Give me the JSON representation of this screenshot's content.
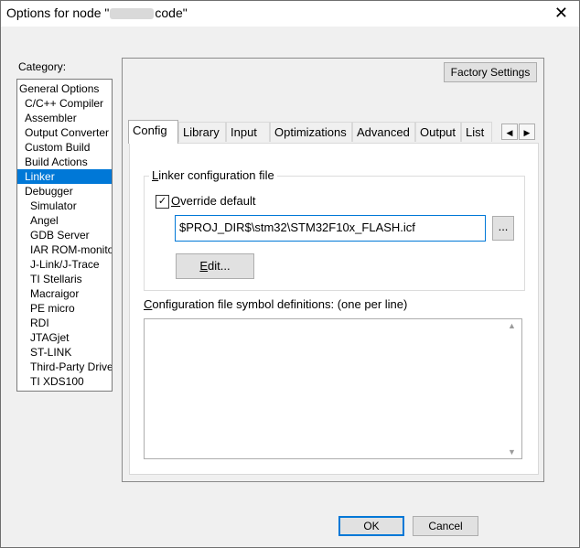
{
  "window": {
    "title_prefix": "Options for node \"",
    "title_suffix": "code\"",
    "close_glyph": "✕"
  },
  "category": {
    "label": "Category:",
    "items": [
      "General Options",
      "C/C++ Compiler",
      "Assembler",
      "Output Converter",
      "Custom Build",
      "Build Actions",
      "Linker",
      "Debugger",
      "Simulator",
      "Angel",
      "GDB Server",
      "IAR ROM-monitor",
      "J-Link/J-Trace",
      "TI Stellaris",
      "Macraigor",
      "PE micro",
      "RDI",
      "JTAGjet",
      "ST-LINK",
      "Third-Party Driver",
      "TI XDS100"
    ],
    "selected": "Linker"
  },
  "buttons": {
    "factory": "Factory Settings",
    "ok": "OK",
    "cancel": "Cancel",
    "browse": "...",
    "edit": "Edit..."
  },
  "tabs": [
    "Config",
    "Library",
    "Input",
    "Optimizations",
    "Advanced",
    "Output",
    "List"
  ],
  "active_tab": "Config",
  "tab_scroll": {
    "left": "◀",
    "right": "▶"
  },
  "config": {
    "group_title": "Linker configuration file",
    "override_label": "Override default",
    "override_checked": true,
    "check_glyph": "✓",
    "path_value": "$PROJ_DIR$\\stm32\\STM32F10x_FLASH.icf",
    "symbols_label": "Configuration file symbol definitions: (one per line)",
    "symbols_value": ""
  },
  "colors": {
    "accent": "#0078d7",
    "selection": "#0078d7"
  }
}
